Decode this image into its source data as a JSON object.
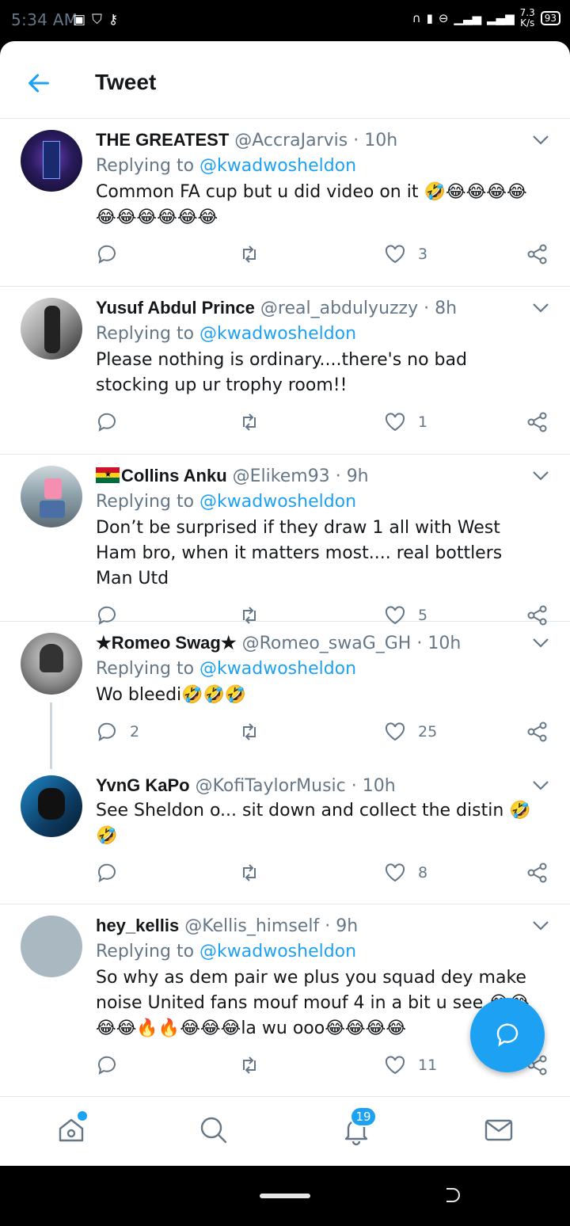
{
  "status_bar": {
    "time": "5:34 AM",
    "speed_value": "7.3",
    "speed_unit": "K/s",
    "battery": "93"
  },
  "header": {
    "title": "Tweet"
  },
  "tweets": [
    {
      "name": "THE GREATEST",
      "handle": "@AccraJarvis",
      "time": "10h",
      "reply_prefix": "Replying to",
      "reply_to": "@kwadwosheldon",
      "text": "Common FA cup but u did video on it 🤣😂😂😂😂😂😂😂😂😂😂",
      "replies": "",
      "likes": "3"
    },
    {
      "name": "Yusuf Abdul Prince",
      "handle": "@real_abdulyuzzy",
      "time": "8h",
      "reply_prefix": "Replying to",
      "reply_to": "@kwadwosheldon",
      "text": "Please nothing is ordinary....there's no bad stocking up ur trophy room!!",
      "replies": "",
      "likes": "1"
    },
    {
      "name": "Collins Anku",
      "flag": "ghana-flag",
      "handle": "@Elikem93",
      "time": "9h",
      "reply_prefix": "Replying to",
      "reply_to": "@kwadwosheldon",
      "text": "Don’t be surprised if they draw 1 all with West Ham bro, when it matters most.... real bottlers Man Utd",
      "replies": "",
      "likes": "5"
    },
    {
      "name": "★Romeo Swag★",
      "handle": "@Romeo_swaG_GH",
      "time": "10h",
      "reply_prefix": "Replying to",
      "reply_to": "@kwadwosheldon",
      "text": "Wo bleedi🤣🤣🤣",
      "replies": "2",
      "likes": "25"
    },
    {
      "name": "YvnG KaPo",
      "handle": "@KofiTaylorMusic",
      "time": "10h",
      "reply_prefix": "",
      "reply_to": "",
      "text": "See Sheldon o... sit down and collect the distin 🤣🤣",
      "replies": "",
      "likes": "8"
    },
    {
      "name": "hey_kellis",
      "handle": "@Kellis_himself",
      "time": "9h",
      "reply_prefix": "Replying to",
      "reply_to": "@kwadwosheldon",
      "text": "So why as dem pair we plus you squad dey make noise United fans mouf mouf 4 in a bit  u see 😂😂😂😂🔥🔥😂😂😂la wu ooo😂😂😂😂",
      "replies": "",
      "likes": "11"
    }
  ],
  "bottom_nav": {
    "notifications_badge": "19"
  },
  "colors": {
    "accent": "#1da1f2",
    "muted": "#657786",
    "divider": "#e1e8ed"
  }
}
